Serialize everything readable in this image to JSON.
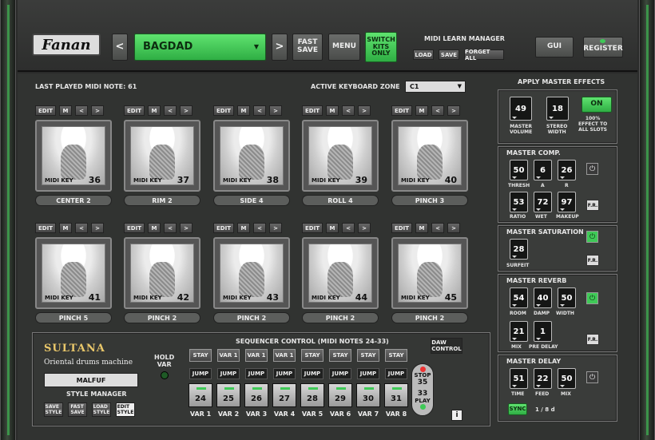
{
  "header": {
    "logo": "Fanan",
    "prev": "<",
    "next": ">",
    "preset": "BAGDAD",
    "fast_save": "FAST\nSAVE",
    "menu": "MENU",
    "switch_kits": "SWITCH\nKITS\nONLY",
    "midi_learn_title": "MIDI LEARN MANAGER",
    "load": "LOAD",
    "save": "SAVE",
    "forget_all": "FORGET ALL",
    "gui": "GUI",
    "register": "REGISTER"
  },
  "status": {
    "last_note_label": "LAST PLAYED MIDI NOTE:",
    "last_note_value": "61",
    "zone_label": "ACTIVE KEYBOARD ZONE",
    "zone_value": "C1"
  },
  "pad_controls": {
    "edit": "EDIT",
    "m": "M",
    "prev": "<",
    "next": ">",
    "midi_key": "MIDI KEY"
  },
  "pads": [
    {
      "key": "36",
      "name": "CENTER 2"
    },
    {
      "key": "37",
      "name": "RIM 2"
    },
    {
      "key": "38",
      "name": "SIDE 4"
    },
    {
      "key": "39",
      "name": "ROLL 4"
    },
    {
      "key": "40",
      "name": "PINCH 3"
    },
    {
      "key": "41",
      "name": "PINCH 5"
    },
    {
      "key": "42",
      "name": "PINCH 2"
    },
    {
      "key": "43",
      "name": "PINCH 2"
    },
    {
      "key": "44",
      "name": "PINCH 2"
    },
    {
      "key": "45",
      "name": "PINCH 2"
    }
  ],
  "brand": {
    "name": "SULTANA",
    "subtitle": "Oriental drums machine",
    "style": "MALFUF",
    "style_manager": "STYLE MANAGER",
    "save_style": "SAVE\nSTYLE",
    "fast_save": "FAST\nSAVE",
    "load_style": "LOAD\nSTYLE",
    "edit_style": "EDIT\nSTYLE"
  },
  "sequencer": {
    "title": "SEQUENCER CONTROL (MIDI NOTES 24-33)",
    "hold_var": "HOLD\nVAR",
    "daw_control": "DAW\nCONTROL",
    "stay_top": [
      "STAY",
      "VAR 1",
      "VAR 1",
      "VAR 1",
      "STAY",
      "STAY",
      "STAY",
      "STAY"
    ],
    "jump": "JUMP",
    "notes": [
      "24",
      "25",
      "26",
      "27",
      "28",
      "29",
      "30",
      "31"
    ],
    "vars": [
      "VAR 1",
      "VAR 2",
      "VAR 3",
      "VAR 4",
      "VAR 5",
      "VAR 6",
      "VAR 7",
      "VAR 8"
    ],
    "stop": "STOP",
    "stop_note": "35",
    "play": "PLAY",
    "play_note": "33",
    "info": "i"
  },
  "master": {
    "title": "APPLY MASTER EFFECTS",
    "volume": "49",
    "volume_label": "MASTER\nVOLUME",
    "width": "18",
    "width_label": "STEREO\nWIDTH",
    "on": "ON",
    "note": "100%\nEFFECT TO\nALL SLOTS"
  },
  "comp": {
    "title": "MASTER COMP.",
    "thresh": "50",
    "a": "6",
    "r": "26",
    "ratio": "53",
    "wet": "72",
    "makeup": "97",
    "l_thresh": "THRESH",
    "l_a": "A",
    "l_r": "R",
    "l_ratio": "RATIO",
    "l_wet": "WET",
    "l_makeup": "MAKEUP",
    "fr": "F.R."
  },
  "sat": {
    "title": "MASTER SATURATION",
    "surfeit": "28",
    "l_surfeit": "SURFEIT",
    "fr": "F.R."
  },
  "reverb": {
    "title": "MASTER REVERB",
    "room": "54",
    "damp": "40",
    "width": "50",
    "mix": "21",
    "predelay": "1",
    "l_room": "ROOM",
    "l_damp": "DAMP",
    "l_width": "WIDTH",
    "l_mix": "MIX",
    "l_predelay": "PRE DELAY",
    "fr": "F.R."
  },
  "delay": {
    "title": "MASTER DELAY",
    "time": "51",
    "feed": "22",
    "mix": "50",
    "l_time": "TIME",
    "l_feed": "FEED",
    "l_mix": "MIX",
    "sync": "SYNC",
    "division": "1 / 8 d"
  },
  "colors": {
    "accent": "#3fc957"
  }
}
